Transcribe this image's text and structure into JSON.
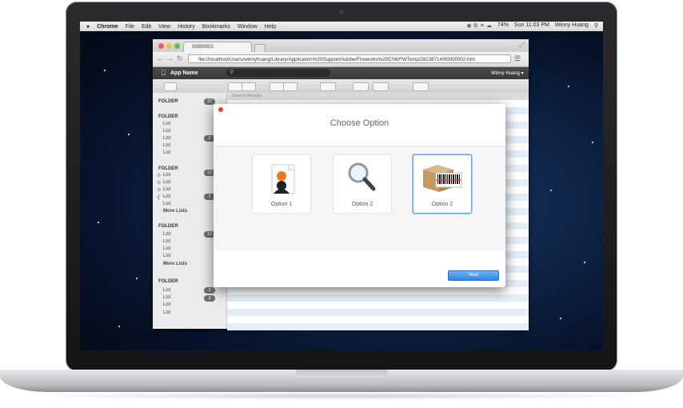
{
  "menubar": {
    "apple": "",
    "app": "Chrome",
    "items": [
      "File",
      "Edit",
      "View",
      "History",
      "Bookmarks",
      "Window",
      "Help"
    ],
    "battery": "74%",
    "clock": "Sun 11:03 PM",
    "user": "Winny Huang"
  },
  "browser": {
    "tab_title": "00000002",
    "url": "file://localhost/Users/winnyhuang/Library/Application%20Support/Adobe/Fireworks%20CS6/FWTemp/28238714/00000002.htm"
  },
  "app": {
    "name": "App Name",
    "user_menu": "Winny Huang ▾",
    "search_placeholder": "Search Results"
  },
  "sidebar": {
    "folder1": "FOLDER",
    "folder1_badge": "27",
    "folder2": "FOLDER",
    "folder2_items": [
      "List",
      "List",
      "List",
      "List",
      "List"
    ],
    "folder2_badge": "2",
    "folder3": "FOLDER",
    "folder3_items": [
      "List",
      "List",
      "List",
      "List",
      "List"
    ],
    "folder3_badge1": "12",
    "folder3_badge2": "2",
    "folder3_more": "More Lists",
    "folder4": "FOLDER",
    "folder4_items": [
      "List",
      "List",
      "List",
      "List"
    ],
    "folder4_badge": "12",
    "folder4_more": "More Lists",
    "folder5": "FOLDER",
    "folder5_items": [
      "List",
      "List",
      "List",
      "List"
    ],
    "folder5_badge1": "2",
    "folder5_badge2": "2"
  },
  "modal": {
    "title": "Choose Option",
    "options": [
      {
        "label": "Option 1",
        "icon": "contact-card-icon"
      },
      {
        "label": "Option 2",
        "icon": "magnifier-icon"
      },
      {
        "label": "Option 2",
        "icon": "barcode-box-icon"
      }
    ],
    "next_label": "Next"
  },
  "colors": {
    "accent": "#2f86e8",
    "selected_border": "#5aa3e6"
  }
}
